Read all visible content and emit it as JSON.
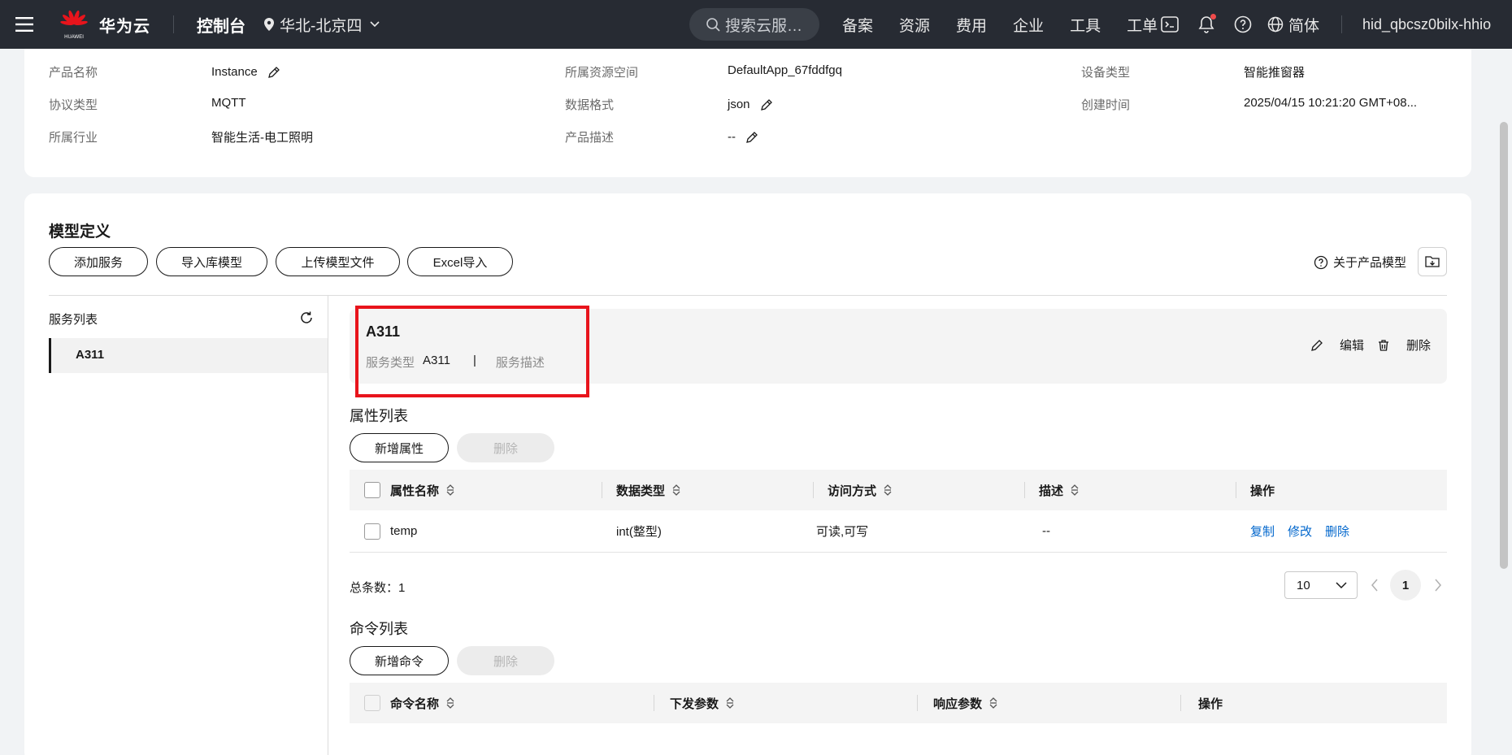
{
  "topbar": {
    "brand": "华为云",
    "logo_caption": "HUAWEI",
    "console": "控制台",
    "region": "华北-北京四",
    "search_placeholder": "搜索云服…",
    "nav": [
      "备案",
      "资源",
      "费用",
      "企业",
      "工具",
      "工单"
    ],
    "language": "简体",
    "username": "hid_qbcsz0bilx-hhio"
  },
  "info": {
    "col1": [
      {
        "label": "产品名称",
        "value": "Instance"
      },
      {
        "label": "协议类型",
        "value": "MQTT"
      },
      {
        "label": "所属行业",
        "value": "智能生活-电工照明"
      }
    ],
    "col2": [
      {
        "label": "所属资源空间",
        "value": "DefaultApp_67fddfgq"
      },
      {
        "label": "数据格式",
        "value": "json"
      },
      {
        "label": "产品描述",
        "value": "--"
      }
    ],
    "col3": [
      {
        "label": "设备类型",
        "value": "智能推窗器"
      },
      {
        "label": "创建时间",
        "value": "2025/04/15 10:21:20 GMT+08..."
      }
    ]
  },
  "model": {
    "title": "模型定义",
    "buttons": [
      "添加服务",
      "导入库模型",
      "上传模型文件",
      "Excel导入"
    ],
    "about": "关于产品模型",
    "service_list_title": "服务列表",
    "services": [
      "A311"
    ],
    "selected_service": {
      "name": "A311",
      "type_label": "服务类型",
      "type_value": "A311",
      "separator": "|",
      "desc_label": "服务描述",
      "edit": "编辑",
      "delete": "删除"
    },
    "properties": {
      "title": "属性列表",
      "add_button": "新增属性",
      "delete_button": "删除",
      "columns": [
        "属性名称",
        "数据类型",
        "访问方式",
        "描述",
        "操作"
      ],
      "rows": [
        {
          "name": "temp",
          "type": "int(整型)",
          "access": "可读,可写",
          "desc": "--",
          "actions": [
            "复制",
            "修改",
            "删除"
          ]
        }
      ],
      "total_label": "总条数：1",
      "page_size": "10",
      "current_page": "1"
    },
    "commands": {
      "title": "命令列表",
      "add_button": "新增命令",
      "delete_button": "删除",
      "columns": [
        "命令名称",
        "下发参数",
        "响应参数",
        "操作"
      ]
    }
  }
}
